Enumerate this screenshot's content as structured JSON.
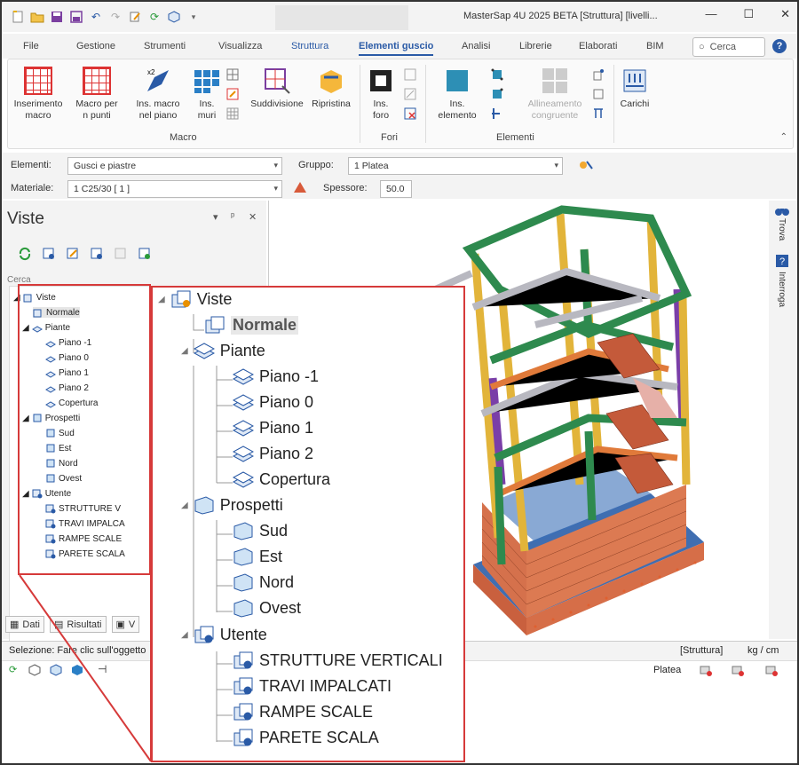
{
  "window": {
    "title": "MasterSap 4U 2025 BETA [Struttura] [livelli...",
    "minimize": "—",
    "maximize": "☐",
    "close": "✕"
  },
  "menu": {
    "items": [
      "File",
      "Gestione",
      "Strumenti",
      "Visualizza",
      "Struttura",
      "Elementi guscio",
      "Analisi",
      "Librerie",
      "Elaborati",
      "BIM"
    ],
    "active": "Elementi guscio",
    "search_placeholder": "Cerca",
    "help": "?"
  },
  "ribbon": {
    "macro": {
      "label": "Macro",
      "buttons": [
        "Inserimento macro",
        "Macro per n punti",
        "Ins. macro nel piano",
        "Ins. muri",
        "Suddivisione",
        "Ripristina"
      ]
    },
    "fori": {
      "label": "Fori",
      "buttons": [
        "Ins. foro"
      ]
    },
    "elementi": {
      "label": "Elementi",
      "buttons": [
        "Ins. elemento",
        "Allineamento congruente",
        "Carichi"
      ]
    }
  },
  "props": {
    "elementi_label": "Elementi:",
    "elementi_value": "Gusci e piastre",
    "gruppo_label": "Gruppo:",
    "gruppo_value": "1 Platea",
    "materiale_label": "Materiale:",
    "materiale_value": "1 C25/30 [ 1 ]",
    "spessore_label": "Spessore:",
    "spessore_value": "50.0"
  },
  "panel": {
    "title": "Viste",
    "pin": "▾",
    "dock": "ᵃ",
    "close": "✕",
    "cerca": "Cerca",
    "tabs": [
      "Dati",
      "Risultati",
      "V"
    ]
  },
  "tree": {
    "root": "Viste",
    "normale": "Normale",
    "piante": "Piante",
    "piante_items": [
      "Piano -1",
      "Piano 0",
      "Piano 1",
      "Piano 2",
      "Copertura"
    ],
    "prospetti": "Prospetti",
    "prospetti_items": [
      "Sud",
      "Est",
      "Nord",
      "Ovest"
    ],
    "utente": "Utente",
    "utente_items_full": [
      "STRUTTURE VERTICALI",
      "TRAVI IMPALCATI",
      "RAMPE SCALE",
      "PARETE SCALA"
    ],
    "utente_items_small": [
      "STRUTTURE V",
      "TRAVI IMPALCA",
      "RAMPE SCALE",
      "PARETE SCALA"
    ]
  },
  "right_sidebar": {
    "trova": "Trova",
    "interroga": "Interroga"
  },
  "status": {
    "selezione": "Selezione: Fare clic sull'oggetto",
    "struttura": "[Struttura]",
    "units": "kg / cm",
    "platea": "Platea"
  },
  "colors": {
    "accent": "#2a5aa6",
    "highlight_border": "#d63a3a"
  }
}
